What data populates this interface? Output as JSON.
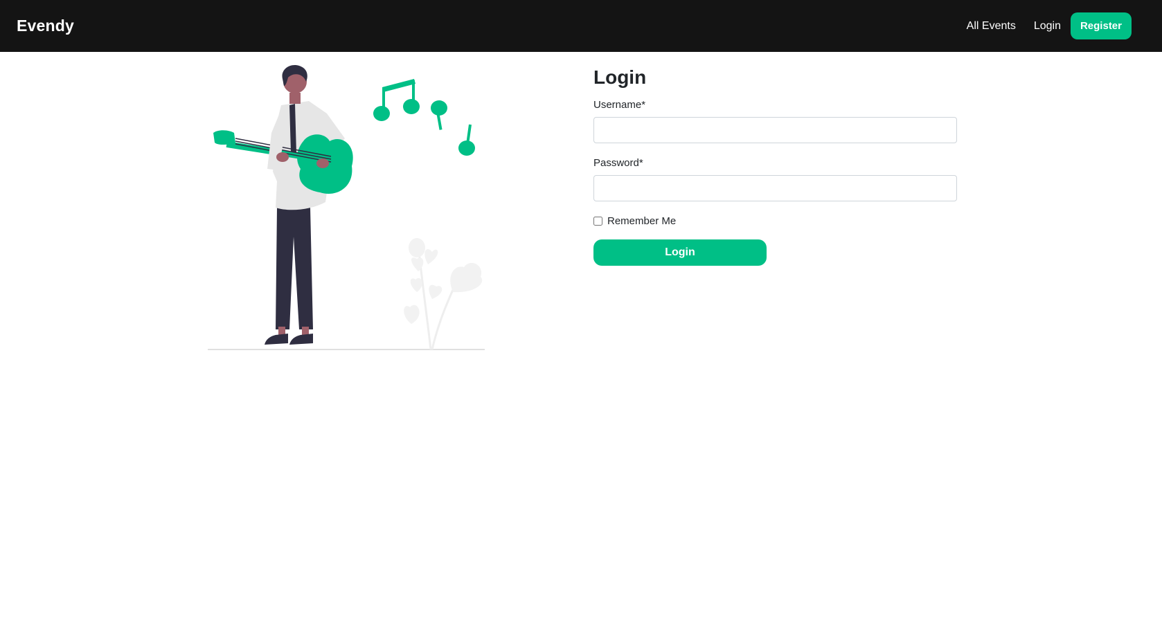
{
  "colors": {
    "accent": "#00BF86",
    "navbar_bg": "#141414",
    "skin": "#A0616A",
    "dark": "#2F2E41",
    "shirt": "#E6E6E6",
    "plant": "#F2F2F2"
  },
  "navbar": {
    "brand": "Evendy",
    "links": [
      "All Events",
      "Login"
    ],
    "register_label": "Register"
  },
  "illustration": {
    "subject": "person-playing-guitar-with-music-notes"
  },
  "login_form": {
    "title": "Login",
    "username_label": "Username*",
    "username_value": "",
    "password_label": "Password*",
    "password_value": "",
    "remember_label": "Remember Me",
    "remember_checked": false,
    "submit_label": "Login"
  }
}
